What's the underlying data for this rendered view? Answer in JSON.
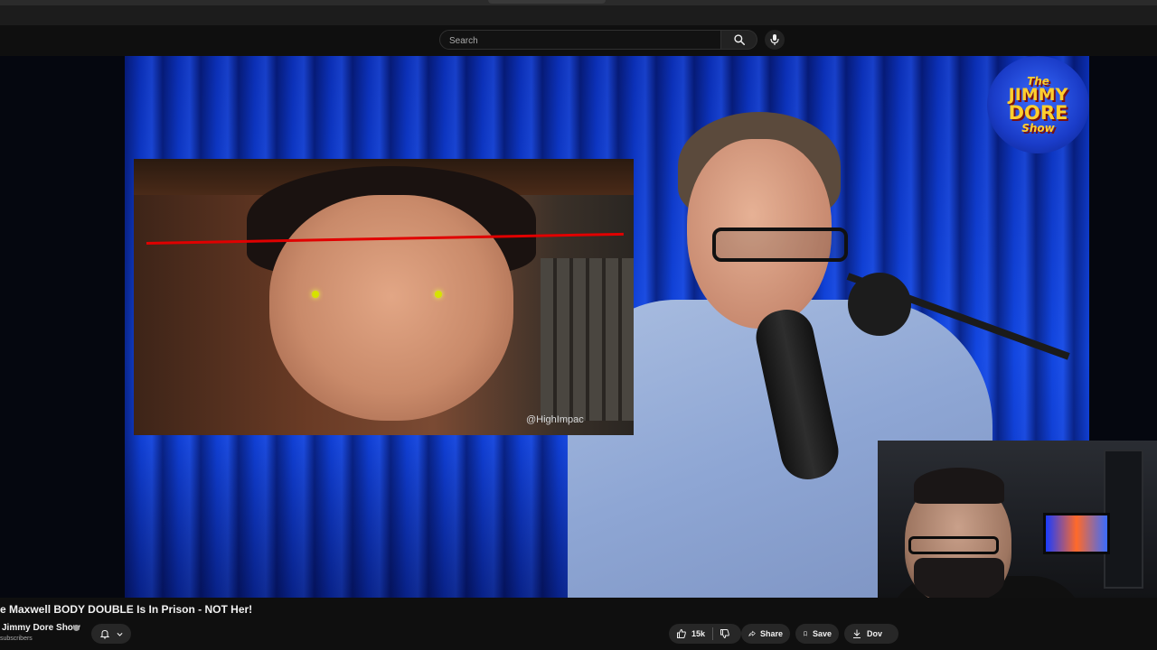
{
  "masthead": {
    "search_placeholder": "Search"
  },
  "video": {
    "inset_watermark": "@HighImpac",
    "logo": {
      "line1": "The",
      "line2": "JIMMY",
      "line3": "DORE",
      "line4": "Show"
    }
  },
  "info": {
    "title": "e Maxwell BODY DOUBLE Is In Prison - NOT Her!",
    "channel_name": "Jimmy Dore Show",
    "subscribers": "subscribers"
  },
  "actions": {
    "like_count": "15k",
    "share_label": "Share",
    "save_label": "Save",
    "download_label": "Dov"
  },
  "colors": {
    "background": "#0f0f0f",
    "pill": "#272727",
    "curtain_blue": "#1246e0",
    "red_line": "#e00000"
  }
}
